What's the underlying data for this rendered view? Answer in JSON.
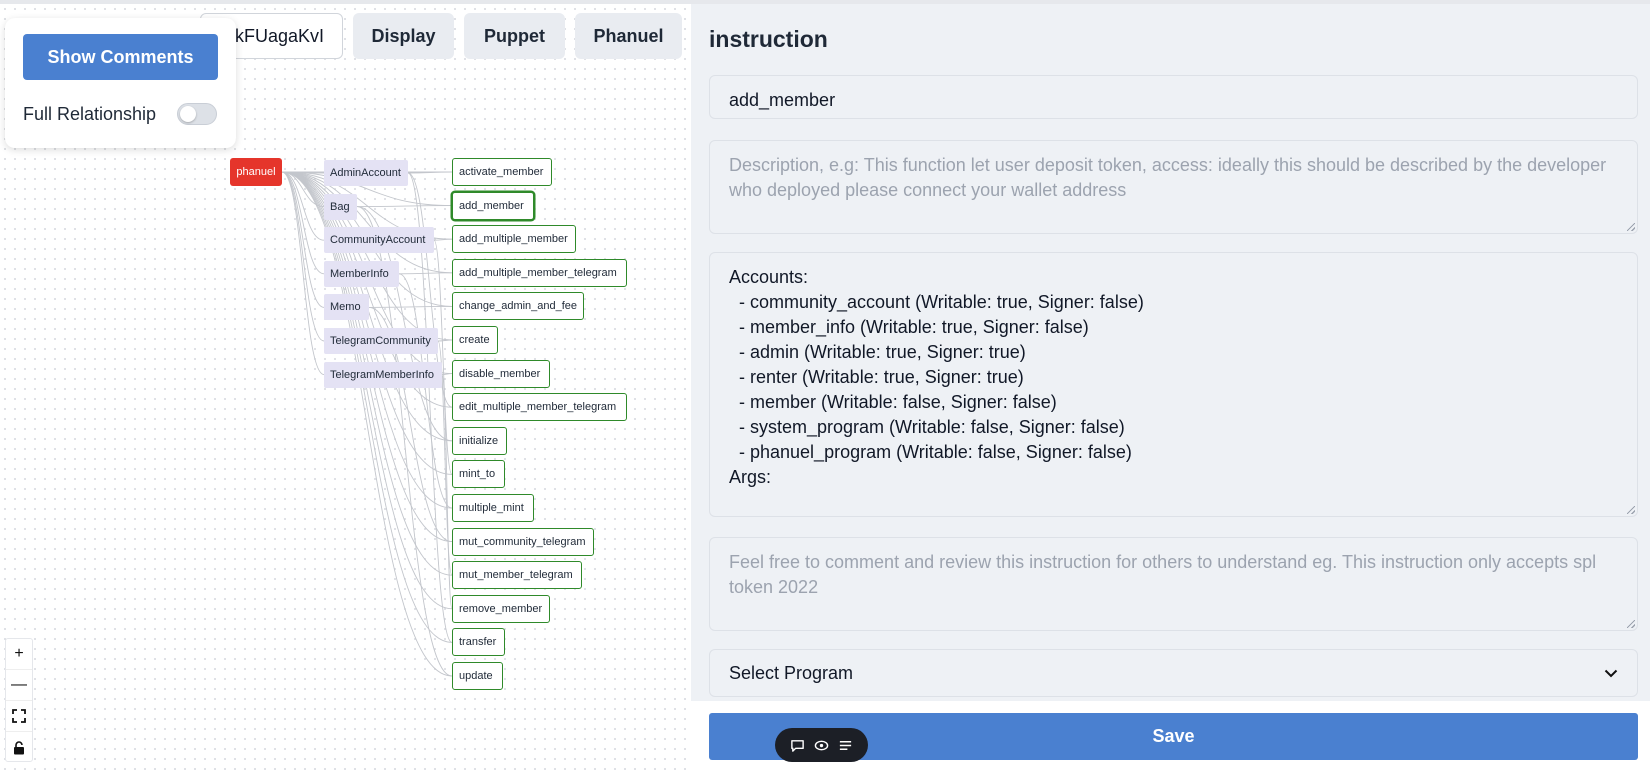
{
  "toolbar": {
    "address_value": "kFUagaKvI",
    "display_label": "Display",
    "puppet_label": "Puppet",
    "phanuel_label": "Phanuel"
  },
  "panel": {
    "show_comments_label": "Show Comments",
    "full_relationship_label": "Full Relationship",
    "full_relationship_on": false
  },
  "graph": {
    "root": "phanuel",
    "accounts": [
      "AdminAccount",
      "Bag",
      "CommunityAccount",
      "MemberInfo",
      "Memo",
      "TelegramCommunity",
      "TelegramMemberInfo"
    ],
    "instructions": [
      "activate_member",
      "add_member",
      "add_multiple_member",
      "add_multiple_member_telegram",
      "change_admin_and_fee",
      "create",
      "disable_member",
      "edit_multiple_member_telegram",
      "initialize",
      "mint_to",
      "multiple_mint",
      "mut_community_telegram",
      "mut_member_telegram",
      "remove_member",
      "transfer",
      "update"
    ],
    "selected_instruction": "add_member"
  },
  "zoom_controls": {
    "zoom_in": "+",
    "zoom_out": "—",
    "fit": "⛶",
    "lock": "🔒"
  },
  "floating_bar": {
    "icons": [
      "comment-icon",
      "eye-icon",
      "list-icon"
    ]
  },
  "editor": {
    "heading": "instruction",
    "instruction_name": "add_member",
    "description_placeholder": "Description, e.g: This function let user deposit token, access: ideally this should be described by the developer who deployed please connect your wallet address",
    "accounts_text": "Accounts:\n  - community_account (Writable: true, Signer: false)\n  - member_info (Writable: true, Signer: false)\n  - admin (Writable: true, Signer: true)\n  - renter (Writable: true, Signer: true)\n  - member (Writable: false, Signer: false)\n  - system_program (Writable: false, Signer: false)\n  - phanuel_program (Writable: false, Signer: false)\nArgs:",
    "comment_placeholder": "Feel free to comment and review this instruction for others to understand eg. This instruction only accepts spl token 2022",
    "select_program_label": "Select Program",
    "save_label": "Save"
  },
  "colors": {
    "primary": "#4a80d0",
    "root_node": "#e5352b",
    "instruction_border": "#2f8a2a",
    "account_node": "#e4e2f4"
  }
}
